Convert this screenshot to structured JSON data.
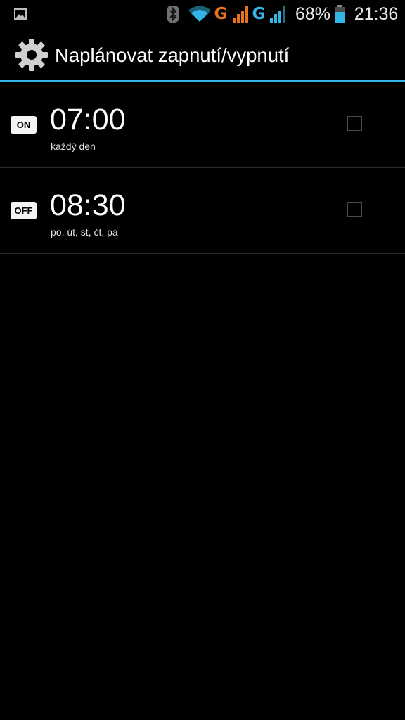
{
  "status_bar": {
    "icons": [
      "gallery-icon",
      "bluetooth-icon",
      "wifi-icon",
      "signal-icon",
      "signal-icon",
      "battery-icon"
    ],
    "network_type_1": "G",
    "network_type_2": "G",
    "battery_percent": "68%",
    "time": "21:36",
    "colors": {
      "network_1": "#e8731f",
      "network_2": "#33b5e5",
      "wifi": "#33b5e5",
      "battery": "#33b5e5"
    }
  },
  "action_bar": {
    "icon": "gear-icon",
    "title": "Naplánovat zapnutí/vypnutí",
    "accent_color": "#33b5e5"
  },
  "schedules": [
    {
      "badge": "ON",
      "time": "07:00",
      "days": "každý den",
      "checked": false
    },
    {
      "badge": "OFF",
      "time": "08:30",
      "days": "po, út, st, čt, pá",
      "checked": false
    }
  ]
}
